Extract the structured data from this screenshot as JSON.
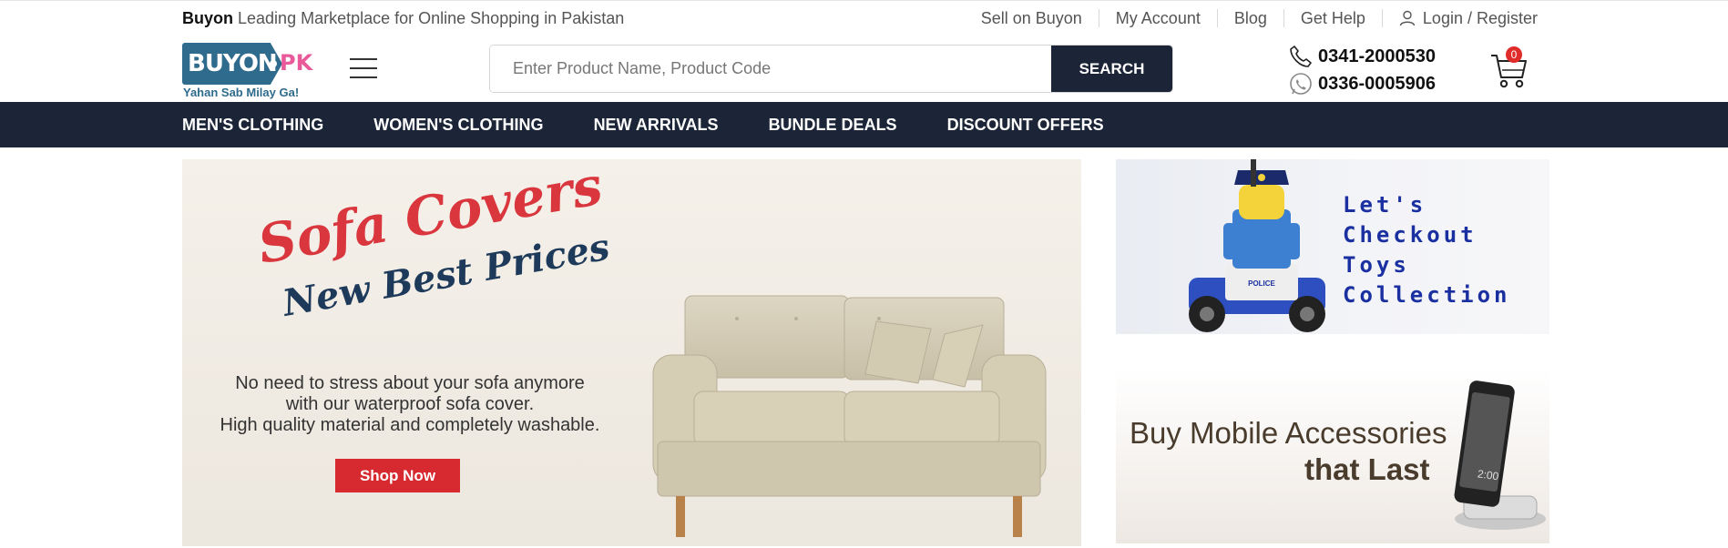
{
  "topbar": {
    "brand": "Buyon",
    "tagline": "Leading Marketplace for Online Shopping in Pakistan",
    "links": [
      "Sell on Buyon",
      "My Account",
      "Blog",
      "Get Help"
    ],
    "login": "Login / Register"
  },
  "logo": {
    "main": "BUYON",
    "suffix": "PK",
    "subtitle": "Yahan Sab Milay Ga!"
  },
  "search": {
    "placeholder": "Enter Product Name, Product Code",
    "button": "SEARCH"
  },
  "contact": {
    "phone": "0341-2000530",
    "whatsapp": "0336-0005906"
  },
  "cart": {
    "count": "0"
  },
  "nav": [
    "MEN'S CLOTHING",
    "WOMEN'S CLOTHING",
    "NEW ARRIVALS",
    "BUNDLE DEALS",
    "DISCOUNT OFFERS"
  ],
  "hero": {
    "title": "Sofa Covers",
    "subtitle": "New Best Prices",
    "line1": "No need to stress about your sofa anymore",
    "line2": "with our waterproof sofa cover.",
    "line3": "High quality material and completely washable.",
    "cta": "Shop Now"
  },
  "side_banner_1": {
    "line1": "Let's",
    "line2": "Checkout",
    "line3": "Toys",
    "line4": "Collection",
    "police_badge": "POLICE"
  },
  "side_banner_2": {
    "line1": "Buy Mobile Accessories",
    "line2": "that Last",
    "clock": "2:00"
  },
  "colors": {
    "navy": "#1b2537",
    "accent_red": "#d72a30",
    "brand_blue": "#2f6b8c",
    "brand_pink": "#e85a9a"
  },
  "icons": [
    "menu-icon",
    "user-icon",
    "phone-icon",
    "whatsapp-icon",
    "cart-icon"
  ]
}
